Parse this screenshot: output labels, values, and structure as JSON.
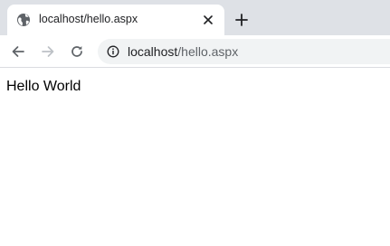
{
  "tab": {
    "title": "localhost/hello.aspx",
    "favicon": "globe-icon",
    "close_icon": "close-icon"
  },
  "new_tab_icon": "plus-icon",
  "toolbar": {
    "back_icon": "arrow-left-icon",
    "forward_icon": "arrow-right-icon",
    "reload_icon": "reload-icon",
    "site_info_icon": "info-icon"
  },
  "address_bar": {
    "host": "localhost",
    "path": "/hello.aspx"
  },
  "page": {
    "text": "Hello World"
  },
  "colors": {
    "tabstrip_bg": "#dee1e6",
    "omnibox_bg": "#f1f3f4",
    "icon": "#5f6368"
  }
}
